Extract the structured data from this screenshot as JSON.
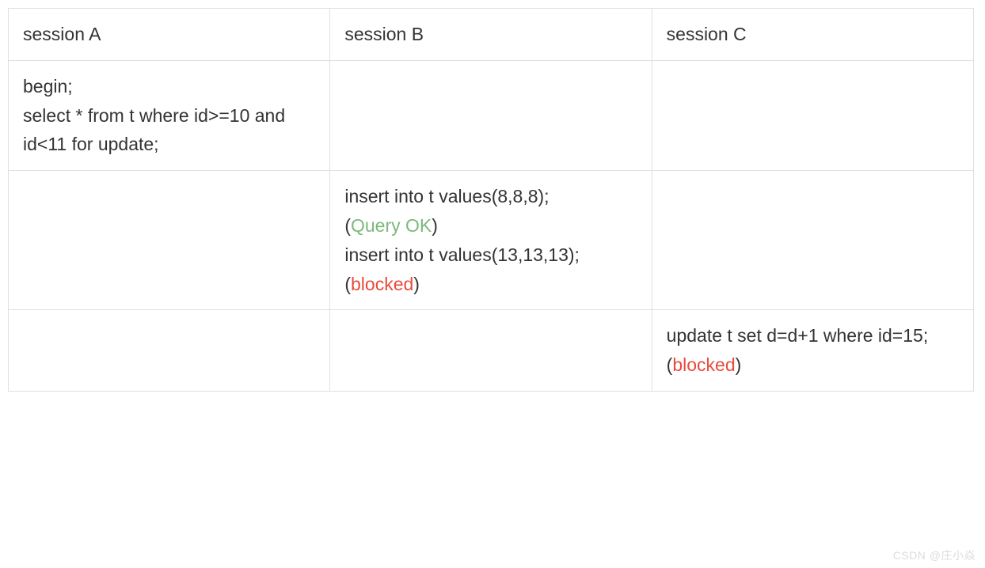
{
  "table": {
    "headers": [
      "session A",
      "session B",
      "session C"
    ],
    "rows": [
      {
        "a": {
          "lines": [
            {
              "text": "begin;"
            },
            {
              "text": "select * from t where id>=10 and id<11 for update;"
            }
          ]
        },
        "b": {
          "lines": []
        },
        "c": {
          "lines": []
        }
      },
      {
        "a": {
          "lines": []
        },
        "b": {
          "lines": [
            {
              "text": "insert into t values(8,8,8);"
            },
            {
              "paren_open": "(",
              "status_text": "Query OK",
              "paren_close": ")",
              "status_class": "ok"
            },
            {
              "text": "insert into t values(13,13,13);"
            },
            {
              "paren_open": "(",
              "status_text": "blocked",
              "paren_close": ")",
              "status_class": "blocked"
            }
          ]
        },
        "c": {
          "lines": []
        }
      },
      {
        "a": {
          "lines": []
        },
        "b": {
          "lines": []
        },
        "c": {
          "lines": [
            {
              "text": "update t set d=d+1 where id=15;"
            },
            {
              "paren_open": "(",
              "status_text": "blocked",
              "paren_close": ")",
              "status_class": "blocked"
            }
          ]
        }
      }
    ]
  },
  "watermark": "CSDN @庄小焱"
}
